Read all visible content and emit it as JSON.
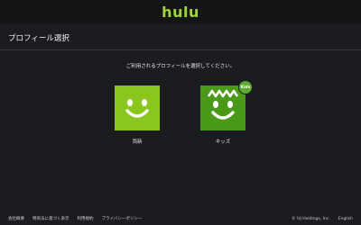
{
  "header": {
    "logo_text": "hulu"
  },
  "page": {
    "title": "プロフィール選択"
  },
  "prompt": "ご利用されるプロフィールを選択してください。",
  "profiles": [
    {
      "name": "両新",
      "avatar": "smiley-face-icon",
      "color": "#8ac61c"
    },
    {
      "name": "キッズ",
      "avatar": "kids-face-icon",
      "color": "#4a9a17",
      "badge": "Kids"
    }
  ],
  "footer": {
    "links": [
      "会社概要",
      "特商法に基づく表示",
      "利用規約",
      "プライバシーポリシー"
    ],
    "copyright": "© HJ Holdings, Inc.",
    "language": "English"
  }
}
